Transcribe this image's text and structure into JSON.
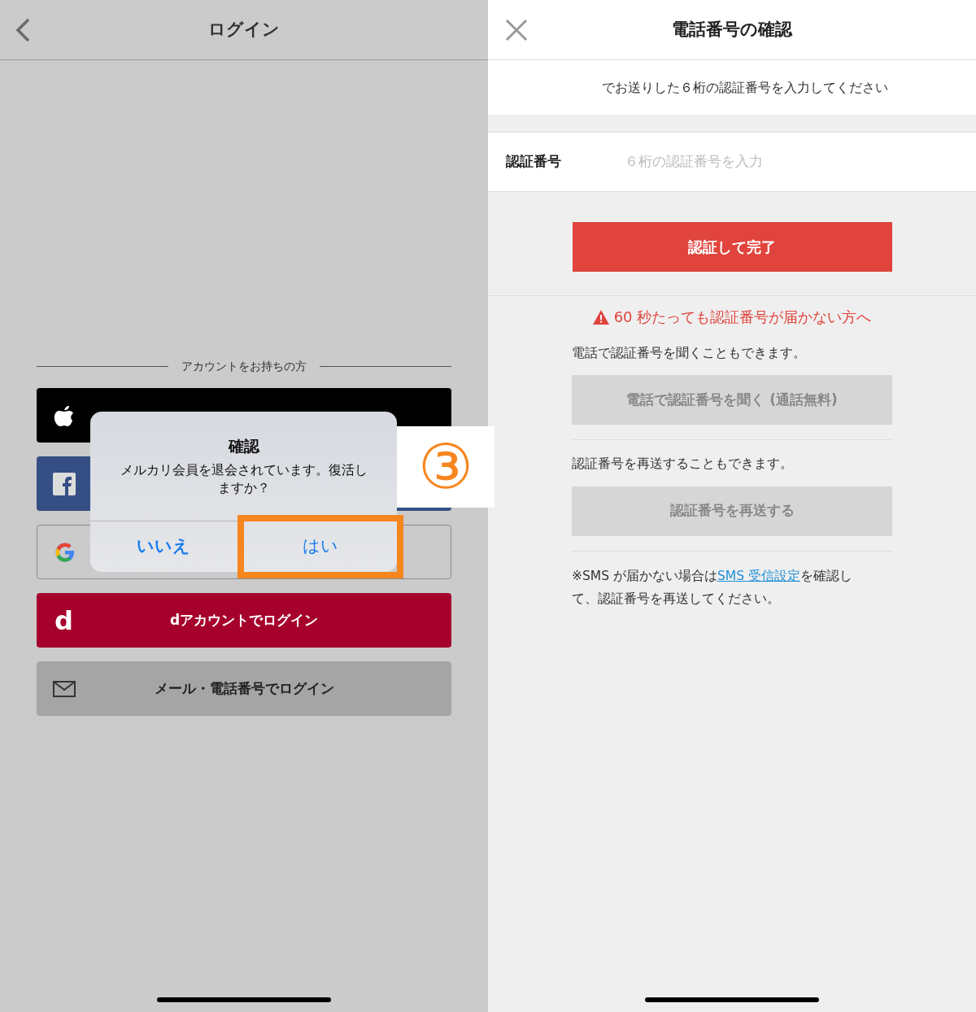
{
  "login_screen": {
    "title": "ログイン",
    "section_label": "アカウントをお持ちの方",
    "buttons": [
      {
        "kind": "apple"
      },
      {
        "kind": "facebook"
      },
      {
        "kind": "google"
      },
      {
        "kind": "docomo",
        "icon_text": "d",
        "label": "dアカウントでログイン"
      },
      {
        "kind": "mail",
        "label": "メール・電話番号でログイン"
      }
    ]
  },
  "dialog": {
    "title": "確認",
    "message": "メルカリ会員を退会されています。復活しますか？",
    "buttons": [
      {
        "label": "いいえ",
        "selected": false
      },
      {
        "label": "はい",
        "selected": true
      }
    ]
  },
  "step_badge": "③",
  "verify_screen": {
    "title": "電話番号の確認",
    "instruction": "でお送りした６桁の認証番号を入力してください",
    "field": {
      "label": "認証番号",
      "placeholder": "６桁の認証番号を入力"
    },
    "submit": "認証して完了",
    "warning": "60 秒たっても認証番号が届かない方へ",
    "sections": [
      {
        "text": "電話で認証番号を聞くこともできます。",
        "button": "電話で認証番号を聞く (通話無料)"
      },
      {
        "text": "認証番号を再送することもできます。",
        "button": "認証番号を再送する"
      }
    ],
    "note": {
      "before": "※SMS が届かない場合は",
      "link": "SMS 受信設定",
      "after": "を確認して、認証番号を再送してください。"
    }
  }
}
